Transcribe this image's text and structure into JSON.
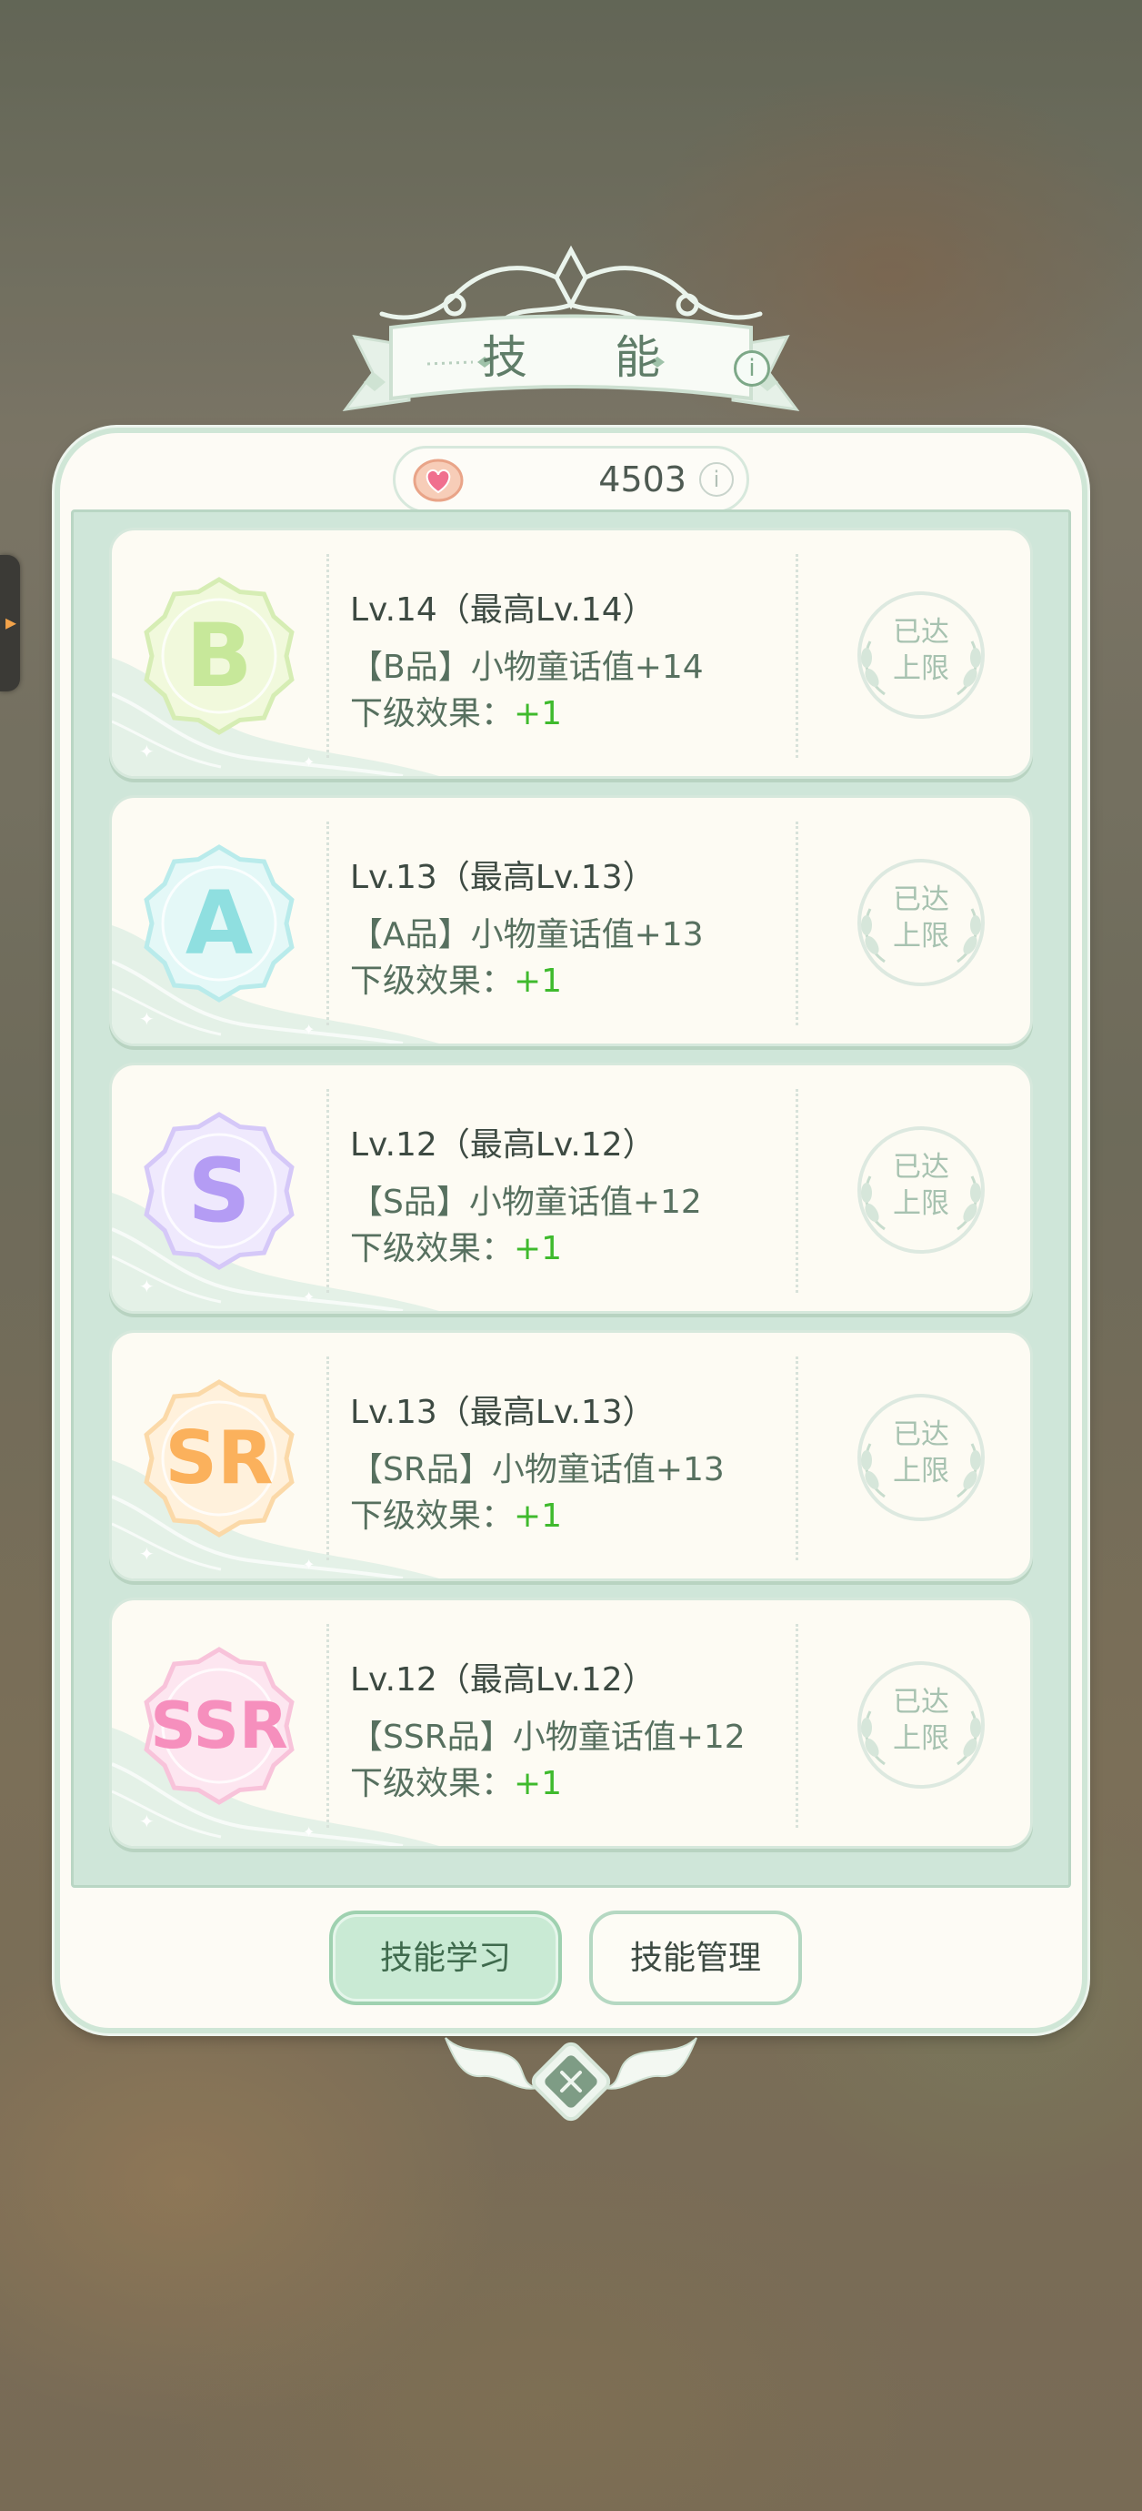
{
  "panel": {
    "title": "技 能",
    "title_info_icon": "info-icon",
    "currency": {
      "icon": "heart-shell-icon",
      "value": "4503",
      "info_icon": "info-icon"
    }
  },
  "skills": [
    {
      "grade": "B",
      "grade_color": "#c7e89a",
      "badge_fill": "#f1f9dc",
      "badge_border": "#d6edb4",
      "level": "Lv.14（最高Lv.14）",
      "effect": "【B品】小物童话值+14",
      "next_label": "下级效果：",
      "next_value": "+1",
      "status": "已达\n上限",
      "status_line1": "已达",
      "status_line2": "上限"
    },
    {
      "grade": "A",
      "grade_color": "#8fdfe0",
      "badge_fill": "#e4f8f7",
      "badge_border": "#b9ebeb",
      "level": "Lv.13（最高Lv.13）",
      "effect": "【A品】小物童话值+13",
      "next_label": "下级效果：",
      "next_value": "+1",
      "status_line1": "已达",
      "status_line2": "上限"
    },
    {
      "grade": "S",
      "grade_color": "#b49cf4",
      "badge_fill": "#efe9fd",
      "badge_border": "#d5c8f8",
      "level": "Lv.12（最高Lv.12）",
      "effect": "【S品】小物童话值+12",
      "next_label": "下级效果：",
      "next_value": "+1",
      "status_line1": "已达",
      "status_line2": "上限"
    },
    {
      "grade": "SR",
      "grade_color": "#fbb15c",
      "badge_fill": "#fff1dc",
      "badge_border": "#fbd9a8",
      "level": "Lv.13（最高Lv.13）",
      "effect": "【SR品】小物童话值+13",
      "next_label": "下级效果：",
      "next_value": "+1",
      "status_line1": "已达",
      "status_line2": "上限"
    },
    {
      "grade": "SSR",
      "grade_color": "#f68fbd",
      "badge_fill": "#fde6f0",
      "badge_border": "#f8c3da",
      "level": "Lv.12（最高Lv.12）",
      "effect": "【SSR品】小物童话值+12",
      "next_label": "下级效果：",
      "next_value": "+1",
      "status_line1": "已达",
      "status_line2": "上限"
    }
  ],
  "buttons": {
    "learn": "技能学习",
    "manage": "技能管理",
    "close_icon": "close-icon"
  },
  "colors": {
    "accent_green": "#3fba2d",
    "panel_border": "#cfe6d6",
    "title_green": "#5f7d68"
  }
}
